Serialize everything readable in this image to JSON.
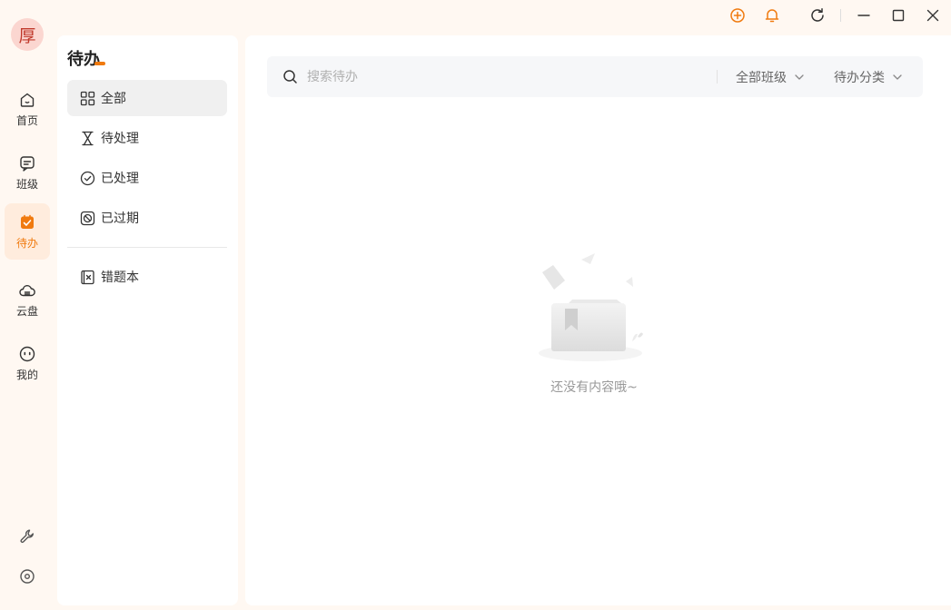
{
  "avatar": {
    "text": "厚"
  },
  "nav": {
    "items": [
      {
        "label": "首页",
        "icon": "home-icon"
      },
      {
        "label": "班级",
        "icon": "class-icon"
      },
      {
        "label": "待办",
        "icon": "todo-icon",
        "active": true
      },
      {
        "label": "云盘",
        "icon": "cloud-icon"
      },
      {
        "label": "我的",
        "icon": "profile-icon"
      }
    ],
    "bottom_icons": [
      "wrench-icon",
      "settings-icon"
    ]
  },
  "titlebar": {
    "icons": [
      "add-icon",
      "bell-icon",
      "refresh-icon",
      "minimize-icon",
      "maximize-icon",
      "close-icon"
    ]
  },
  "panel": {
    "title": "待办",
    "items": [
      {
        "label": "全部",
        "icon": "grid-icon",
        "active": true
      },
      {
        "label": "待处理",
        "icon": "hourglass-icon"
      },
      {
        "label": "已处理",
        "icon": "check-circle-icon"
      },
      {
        "label": "已过期",
        "icon": "expired-icon"
      },
      {
        "label": "错题本",
        "icon": "wrong-book-icon"
      }
    ]
  },
  "search": {
    "placeholder": "搜索待办",
    "value": "",
    "filter_class": "全部班级",
    "filter_category": "待办分类"
  },
  "empty": {
    "text": "还没有内容哦~"
  },
  "colors": {
    "accent": "#f07a0f",
    "active_bg": "#ffecdd",
    "app_bg": "#fff8f2"
  }
}
